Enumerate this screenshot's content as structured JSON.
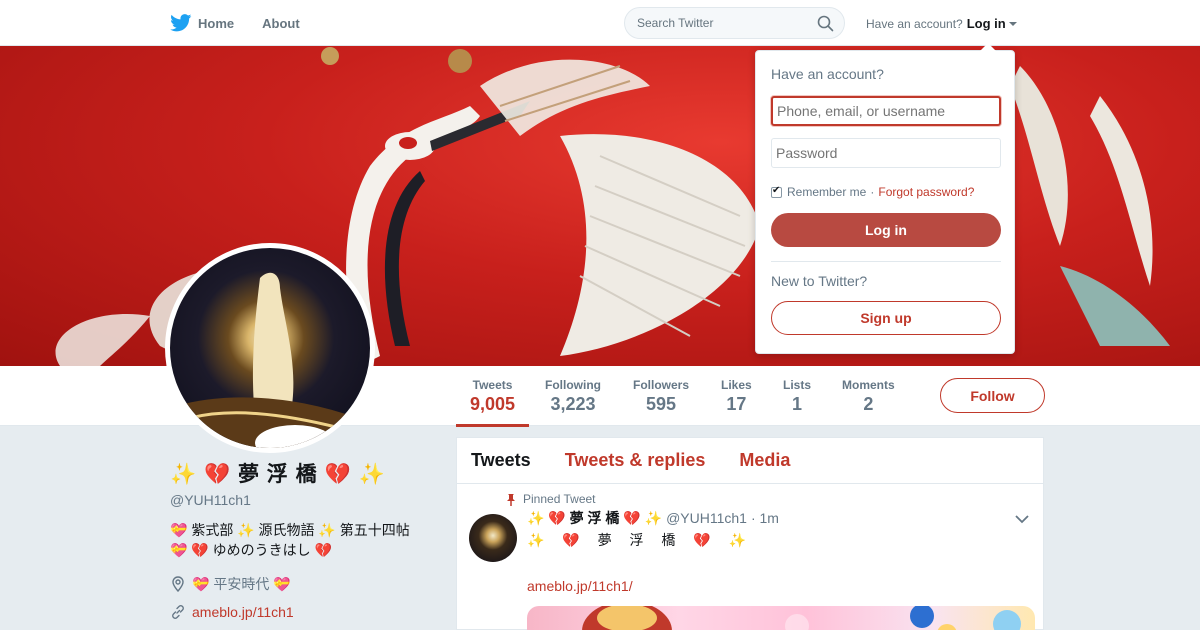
{
  "nav": {
    "home_label": "Home",
    "about_label": "About",
    "search_placeholder": "Search Twitter",
    "account_prompt": "Have an account?",
    "login_label": "Log in"
  },
  "profile_nav": {
    "stats": [
      {
        "label": "Tweets",
        "value": "9,005"
      },
      {
        "label": "Following",
        "value": "3,223"
      },
      {
        "label": "Followers",
        "value": "595"
      },
      {
        "label": "Likes",
        "value": "17"
      },
      {
        "label": "Lists",
        "value": "1"
      },
      {
        "label": "Moments",
        "value": "2"
      }
    ],
    "follow_label": "Follow"
  },
  "profile": {
    "name": "✨ 💔 夢 浮 橋 💔 ✨",
    "handle": "@YUH11ch1",
    "bio_line1": "💝 紫式部 ✨ 源氏物語 ✨ 第五十四帖",
    "bio_line2": "💝 💔 ゆめのうきはし 💔",
    "location": "💝 平安時代 💝",
    "url": "ameblo.jp/11ch1"
  },
  "timeline": {
    "tabs": [
      "Tweets",
      "Tweets & replies",
      "Media"
    ],
    "pinned_label": "Pinned Tweet",
    "tweet": {
      "name": "✨ 💔 夢 浮 橋 💔 ✨",
      "handle": "@YUH11ch1",
      "time": "· 1m",
      "text": "✨ 💔 夢 浮 橋 💔 ✨",
      "link": "ameblo.jp/11ch1/"
    }
  },
  "login_dropdown": {
    "title": "Have an account?",
    "username_placeholder": "Phone, email, or username",
    "password_placeholder": "Password",
    "remember_label": "Remember me",
    "separator": "·",
    "forgot_label": "Forgot password?",
    "login_button": "Log in",
    "new_label": "New to Twitter?",
    "signup_button": "Sign up"
  },
  "colors": {
    "accent": "#c0392b",
    "login_button": "#b84a41",
    "twitter_blue": "#1da1f2"
  },
  "icons": [
    "twitter-bird-icon",
    "search-icon",
    "caret-down-icon",
    "location-pin-icon",
    "link-icon",
    "pin-icon",
    "chevron-down-icon"
  ]
}
